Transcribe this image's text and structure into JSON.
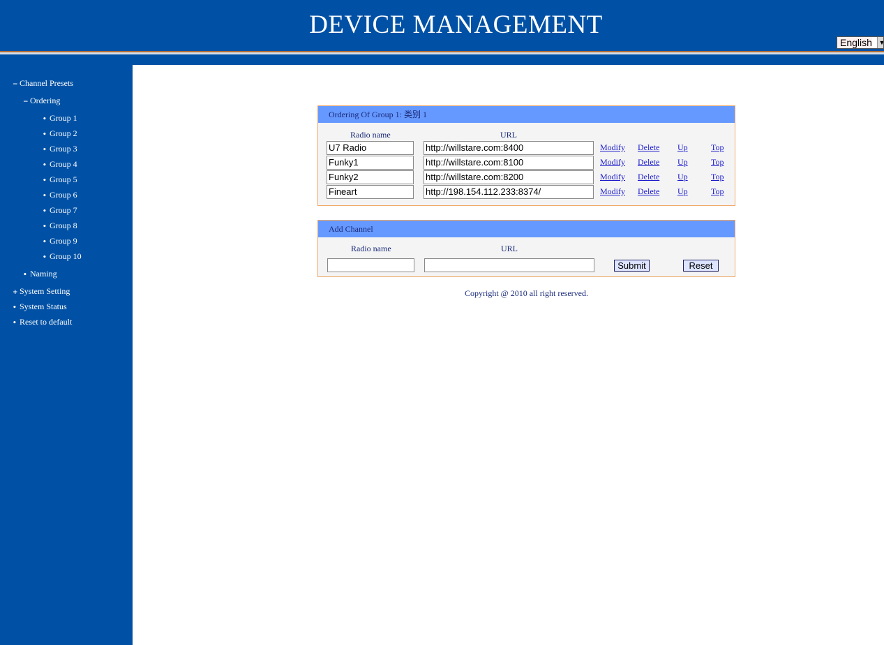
{
  "header": {
    "title": "DEVICE MANAGEMENT",
    "language": "English"
  },
  "sidebar": {
    "channel_presets": "Channel Presets",
    "ordering": "Ordering",
    "groups": [
      "Group 1",
      "Group 2",
      "Group 3",
      "Group 4",
      "Group 5",
      "Group 6",
      "Group 7",
      "Group 8",
      "Group 9",
      "Group 10"
    ],
    "naming": "Naming",
    "system_setting": "System Setting",
    "system_status": "System Status",
    "reset_default": "Reset to default"
  },
  "ordering_panel": {
    "title": "Ordering Of Group 1: 类别 1",
    "col_name": "Radio name",
    "col_url": "URL",
    "rows": [
      {
        "name": "U7 Radio",
        "url": "http://willstare.com:8400"
      },
      {
        "name": "Funky1",
        "url": "http://willstare.com:8100"
      },
      {
        "name": "Funky2",
        "url": "http://willstare.com:8200"
      },
      {
        "name": "Fineart",
        "url": "http://198.154.112.233:8374/"
      }
    ],
    "actions": {
      "modify": "Modify",
      "delete": "Delete",
      "up": "Up",
      "top": "Top"
    }
  },
  "add_panel": {
    "title": "Add Channel",
    "col_name": "Radio name",
    "col_url": "URL",
    "name_value": "",
    "url_value": "",
    "submit": "Submit",
    "reset": "Reset"
  },
  "footer": {
    "copyright": "Copyright @ 2010 all right reserved."
  }
}
